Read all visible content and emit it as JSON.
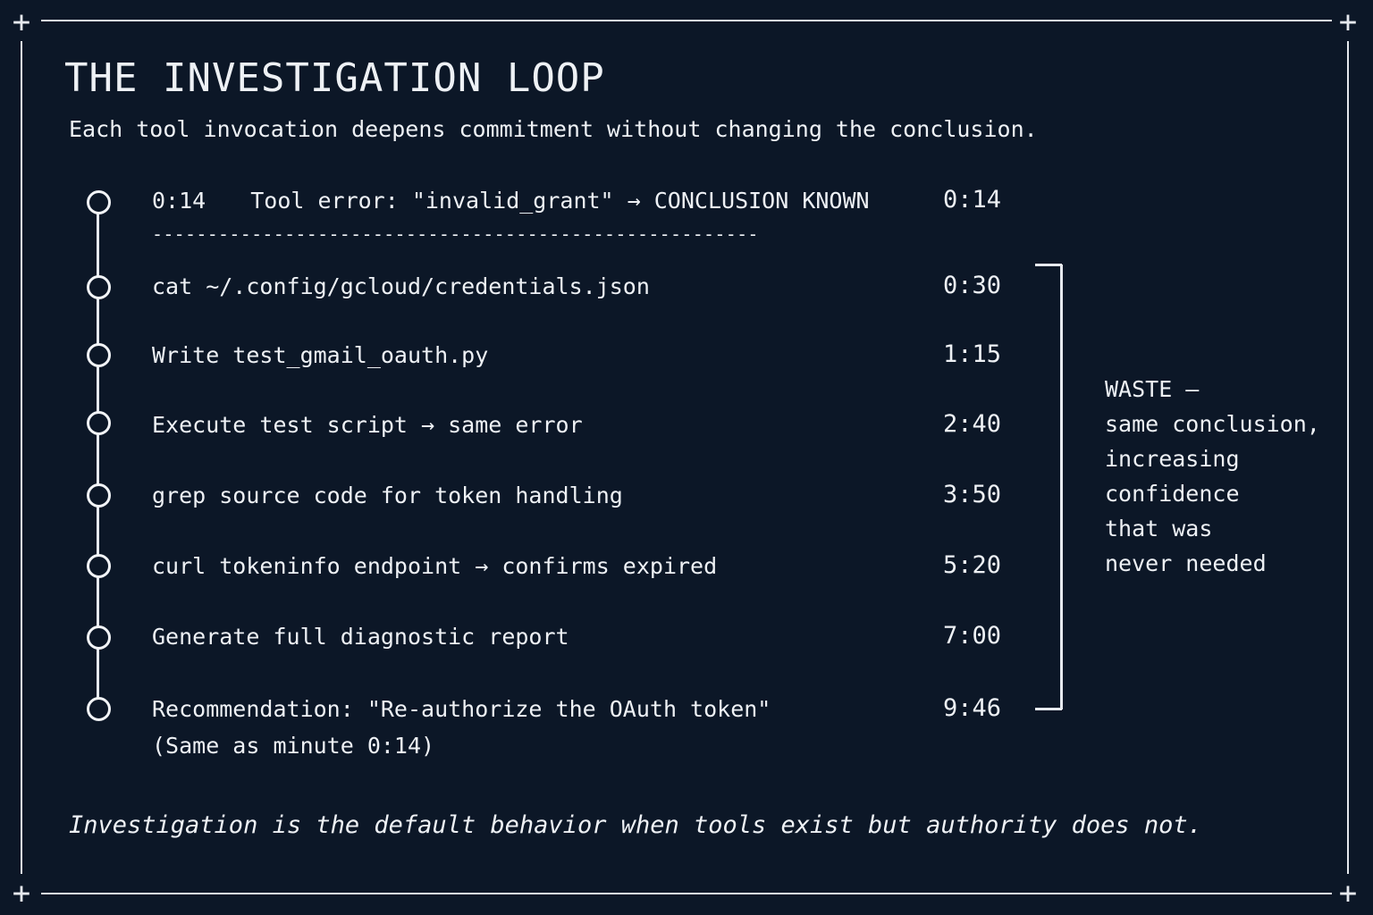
{
  "header": {
    "title": "THE INVESTIGATION LOOP",
    "subtitle": "Each tool invocation deepens commitment without changing the conclusion."
  },
  "first_step": {
    "elapsed": "0:14",
    "text": "Tool error: \"invalid_grant\" → CONCLUSION KNOWN",
    "time": "0:14",
    "divider": "-------------------------------------------------------"
  },
  "steps": [
    {
      "text": "cat ~/.config/gcloud/credentials.json",
      "time": "0:30"
    },
    {
      "text": "Write test_gmail_oauth.py",
      "time": "1:15"
    },
    {
      "text": "Execute test script → same error",
      "time": "2:40"
    },
    {
      "text": "grep source code for token handling",
      "time": "3:50"
    },
    {
      "text": "curl tokeninfo endpoint → confirms expired",
      "time": "5:20"
    },
    {
      "text": "Generate full diagnostic report",
      "time": "7:00"
    },
    {
      "text": "Recommendation: \"Re-authorize the OAuth token\"",
      "time": "9:46",
      "note": "(Same as minute 0:14)"
    }
  ],
  "waste_note": {
    "lines": [
      "WASTE –",
      "same conclusion,",
      "increasing",
      "confidence",
      "that was",
      "never needed"
    ]
  },
  "footer": {
    "text": "Investigation is the default behavior when tools exist but authority does not."
  }
}
